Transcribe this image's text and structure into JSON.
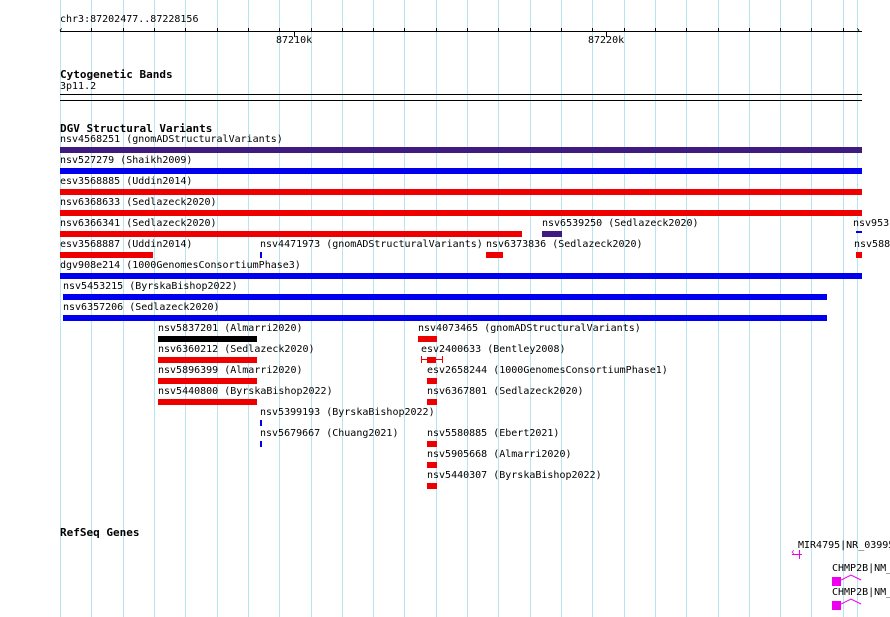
{
  "ruler": {
    "region": "chr3:87202477..87228156",
    "tick_labels": [
      "87210k",
      "87220k"
    ]
  },
  "cytobands": {
    "title": "Cytogenetic Bands",
    "band": "3p11.2"
  },
  "dgv": {
    "title": "DGV Structural Variants",
    "features": [
      {
        "id": "nsv4568251",
        "source": "gnomADStructuralVariants",
        "label": "nsv4568251 (gnomADStructuralVariants)",
        "color": "#3f1b7f"
      },
      {
        "id": "nsv527279",
        "source": "Shaikh2009",
        "label": "nsv527279 (Shaikh2009)",
        "color": "#0000ee"
      },
      {
        "id": "esv3568885",
        "source": "Uddin2014",
        "label": "esv3568885 (Uddin2014)",
        "color": "#ee0000"
      },
      {
        "id": "nsv6368633",
        "source": "Sedlazeck2020",
        "label": "nsv6368633 (Sedlazeck2020)",
        "color": "#ee0000"
      },
      {
        "id": "nsv6366341",
        "source": "Sedlazeck2020",
        "label": "nsv6366341 (Sedlazeck2020)",
        "color": "#ee0000"
      },
      {
        "id": "nsv6539250",
        "source": "Sedlazeck2020",
        "label": "nsv6539250 (Sedlazeck2020)",
        "color": "#3f1b7f"
      },
      {
        "id": "nsv953",
        "source": "",
        "label": "nsv953",
        "color": "#0000ee"
      },
      {
        "id": "esv3568887",
        "source": "Uddin2014",
        "label": "esv3568887 (Uddin2014)",
        "color": "#ee0000"
      },
      {
        "id": "nsv4471973",
        "source": "gnomADStructuralVariants",
        "label": "nsv4471973 (gnomADStructuralVariants)",
        "color": "#0000ee"
      },
      {
        "id": "nsv6373836",
        "source": "Sedlazeck2020",
        "label": "nsv6373836 (Sedlazeck2020)",
        "color": "#ee0000"
      },
      {
        "id": "nsv588",
        "source": "",
        "label": "nsv588",
        "color": "#ee0000"
      },
      {
        "id": "dgv908e214",
        "source": "1000GenomesConsortiumPhase3",
        "label": "dgv908e214 (1000GenomesConsortiumPhase3)",
        "color": "#0000ee"
      },
      {
        "id": "nsv5453215",
        "source": "ByrskaBishop2022",
        "label": "nsv5453215 (ByrskaBishop2022)",
        "color": "#0000ee"
      },
      {
        "id": "nsv6357206",
        "source": "Sedlazeck2020",
        "label": "nsv6357206 (Sedlazeck2020)",
        "color": "#0000ee"
      },
      {
        "id": "nsv5837201",
        "source": "Almarri2020",
        "label": "nsv5837201 (Almarri2020)",
        "color": "#000000"
      },
      {
        "id": "nsv4073465",
        "source": "gnomADStructuralVariants",
        "label": "nsv4073465 (gnomADStructuralVariants)",
        "color": "#ee0000"
      },
      {
        "id": "nsv6360212",
        "source": "Sedlazeck2020",
        "label": "nsv6360212 (Sedlazeck2020)",
        "color": "#ee0000"
      },
      {
        "id": "esv2400633",
        "source": "Bentley2008",
        "label": "esv2400633 (Bentley2008)",
        "color": "#ee0000"
      },
      {
        "id": "nsv5896399",
        "source": "Almarri2020",
        "label": "nsv5896399 (Almarri2020)",
        "color": "#ee0000"
      },
      {
        "id": "esv2658244",
        "source": "1000GenomesConsortiumPhase1",
        "label": "esv2658244 (1000GenomesConsortiumPhase1)",
        "color": "#ee0000"
      },
      {
        "id": "nsv5440800",
        "source": "ByrskaBishop2022",
        "label": "nsv5440800 (ByrskaBishop2022)",
        "color": "#ee0000"
      },
      {
        "id": "nsv6367801",
        "source": "Sedlazeck2020",
        "label": "nsv6367801 (Sedlazeck2020)",
        "color": "#ee0000"
      },
      {
        "id": "nsv5399193",
        "source": "ByrskaBishop2022",
        "label": "nsv5399193 (ByrskaBishop2022)",
        "color": "#0000ee"
      },
      {
        "id": "nsv5679667",
        "source": "Chuang2021",
        "label": "nsv5679667 (Chuang2021)",
        "color": "#0000ee"
      },
      {
        "id": "nsv5580885",
        "source": "Ebert2021",
        "label": "nsv5580885 (Ebert2021)",
        "color": "#ee0000"
      },
      {
        "id": "nsv5905668",
        "source": "Almarri2020",
        "label": "nsv5905668 (Almarri2020)",
        "color": "#ee0000"
      },
      {
        "id": "nsv5440307",
        "source": "ByrskaBishop2022",
        "label": "nsv5440307 (ByrskaBishop2022)",
        "color": "#ee0000"
      }
    ]
  },
  "refseq": {
    "title": "RefSeq Genes",
    "genes": [
      {
        "label": "MIR4795|NR_03995",
        "color": "#ee00ee"
      },
      {
        "label": "CHMP2B|NM_",
        "color": "#ee00ee"
      },
      {
        "label": "CHMP2B|NM_",
        "color": "#ee00ee"
      }
    ]
  }
}
